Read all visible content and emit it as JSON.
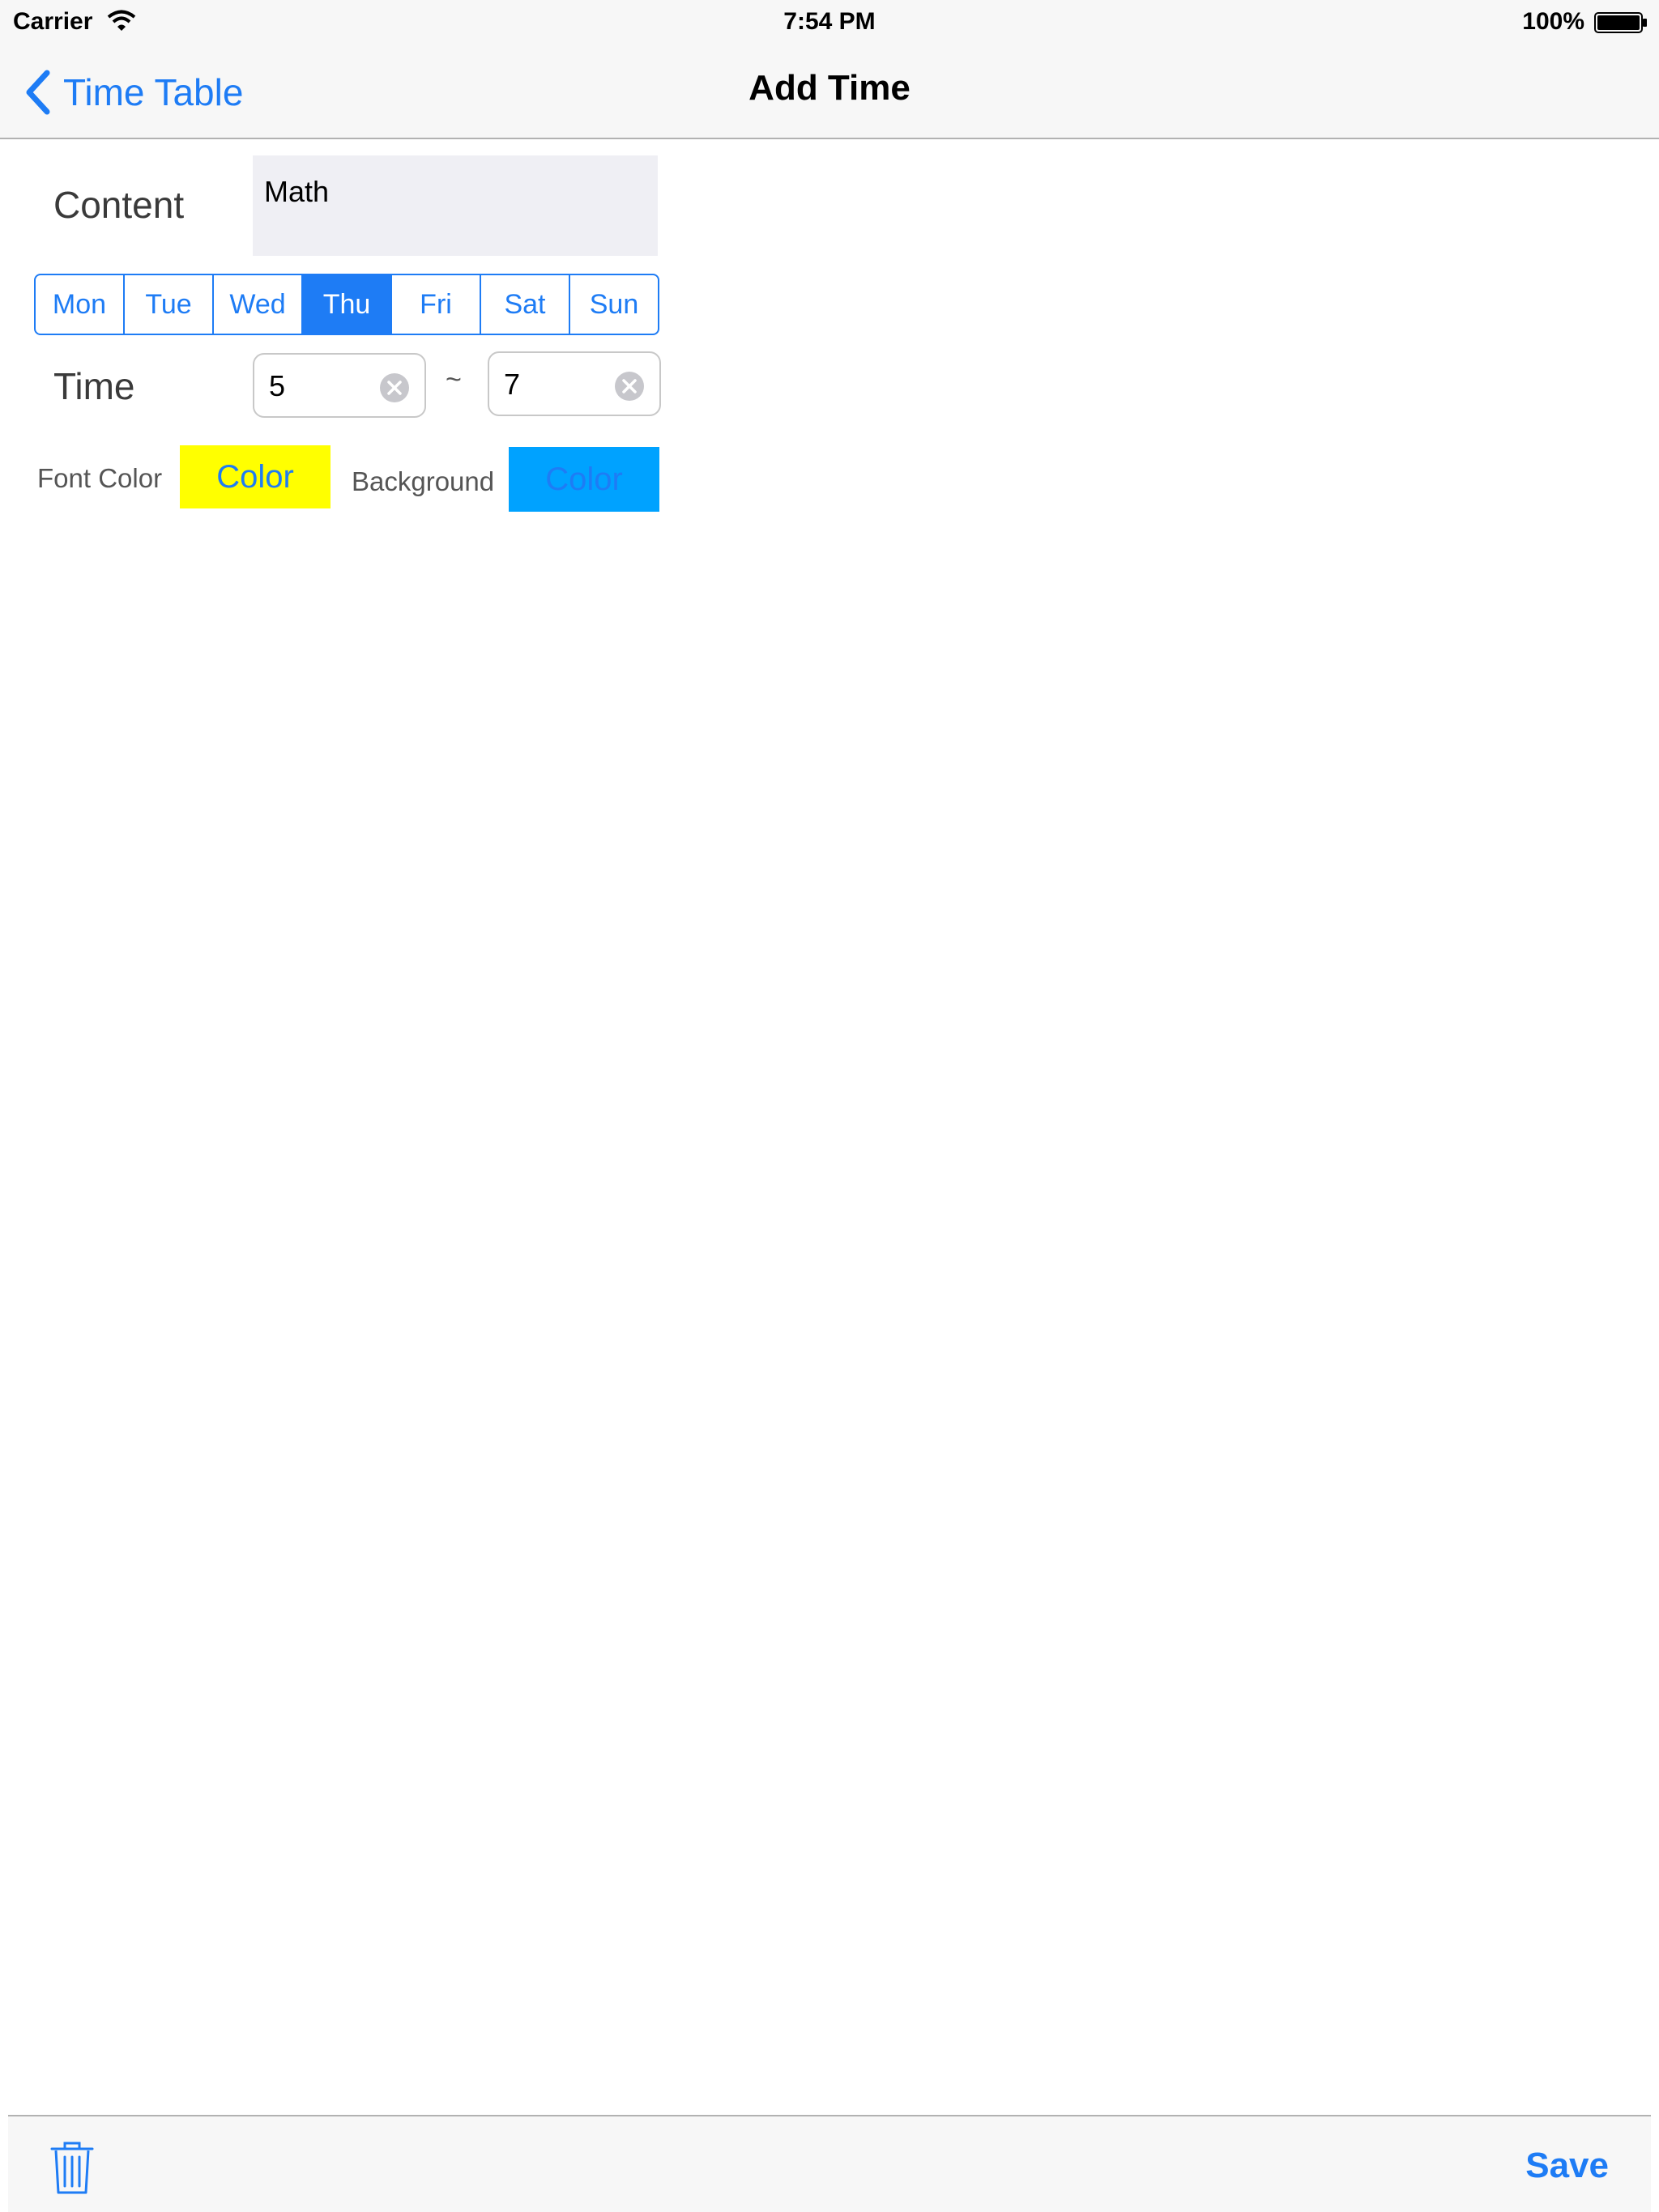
{
  "status_bar": {
    "carrier": "Carrier",
    "time": "7:54 PM",
    "battery": "100%"
  },
  "nav": {
    "back_label": "Time Table",
    "title": "Add Time"
  },
  "form": {
    "content_label": "Content",
    "content_value": "Math",
    "days": [
      "Mon",
      "Tue",
      "Wed",
      "Thu",
      "Fri",
      "Sat",
      "Sun"
    ],
    "selected_day": "Thu",
    "time_label": "Time",
    "time_start": "5",
    "time_separator": "~",
    "time_end": "7",
    "font_color_label": "Font Color",
    "font_color_button": "Color",
    "background_label": "Background",
    "background_button": "Color"
  },
  "toolbar": {
    "save_label": "Save"
  },
  "colors": {
    "accent": "#1e7cf5",
    "font_color_swatch": "#ffff00",
    "background_swatch": "#00a2ff"
  },
  "icons": [
    "wifi-icon",
    "battery-icon",
    "back-chevron-icon",
    "clear-icon",
    "trash-icon"
  ]
}
